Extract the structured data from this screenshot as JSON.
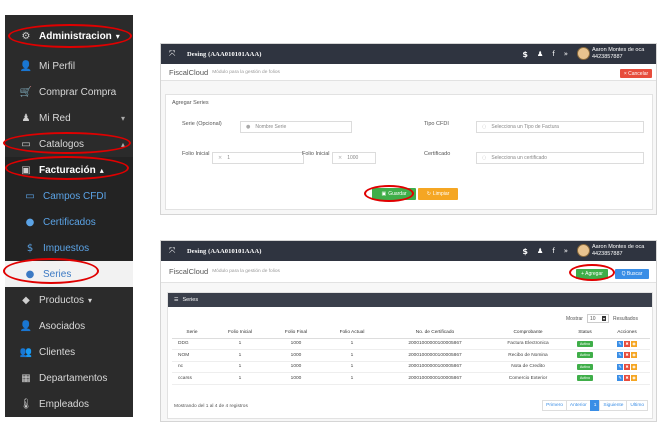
{
  "sidebar": {
    "items": [
      {
        "icon": "⚙",
        "label": "Administracion",
        "caret": "▾"
      },
      {
        "icon": "👤",
        "label": "Mi Perfil"
      },
      {
        "icon": "🛒",
        "label": "Comprar Compra"
      },
      {
        "icon": "♟",
        "label": "Mi Red",
        "right_caret": "▾"
      },
      {
        "icon": "▭",
        "label": "Catalogos",
        "right_caret": "▴"
      },
      {
        "icon": "▣",
        "label": "Facturación",
        "caret": "▴"
      },
      {
        "icon": "▭",
        "label": "Campos CFDI"
      },
      {
        "icon": "●",
        "label": "Certificados"
      },
      {
        "icon": "$",
        "label": "Impuestos"
      },
      {
        "icon": "●",
        "label": "Series"
      },
      {
        "icon": "◆",
        "label": "Productos",
        "caret": "▾"
      },
      {
        "icon": "👤",
        "label": "Asociados"
      },
      {
        "icon": "👥",
        "label": "Clientes"
      },
      {
        "icon": "▦",
        "label": "Departamentos"
      },
      {
        "icon": "🌡",
        "label": "Empleados"
      }
    ]
  },
  "top_panel": {
    "topbar_title": "Desing  (AAA010101AAA)",
    "user_name": "Aaron Montes de oca",
    "user_phone": "4423857887",
    "brand": "FiscalCloud",
    "brand_desc": "Módulo para la gestión de folios",
    "cancel_btn": "× Cancelar",
    "form_title": "Agregar Series",
    "serie_label": "Serie (Opcional)",
    "serie_placeholder": "Nombre Serie",
    "tipo_label": "Tipo CFDI",
    "tipo_placeholder": "Selecciona un Tipo de Factura",
    "folio_inicial_label": "Folio Inicial",
    "folio_inicial_value": "1",
    "folio_final_label": "Folio Inicial",
    "folio_final_value": "1000",
    "cert_label": "Certificado",
    "cert_placeholder": "Selecciona un certificado",
    "guardar_btn": "Guardar",
    "limpiar_btn": "Limpiar"
  },
  "bottom_panel": {
    "topbar_title": "Desing  (AAA010101AAA)",
    "user_name": "Aaron Montes de oca",
    "user_phone": "4423857887",
    "brand": "FiscalCloud",
    "brand_desc": "Módulo para la gestión de folios",
    "agregar_btn": "+ Agregar",
    "buscar_btn": "Q Buscar",
    "table_title": "Series",
    "mostrar_label": "Mostrar",
    "mostrar_value": "10",
    "resultados_label": "Resultados",
    "columns": [
      "Serie",
      "Folio Inicial",
      "Folio Final",
      "Folio Actual",
      "No. de Certificado",
      "Comprobante",
      "Status",
      "Acciones"
    ],
    "rows": [
      {
        "serie": "DDG",
        "inicial": "1",
        "final": "1000",
        "actual": "1",
        "cert": "20001000000100005867",
        "comprobante": "Factura Electronica",
        "status": "Activo"
      },
      {
        "serie": "NOM",
        "inicial": "1",
        "final": "1000",
        "actual": "1",
        "cert": "20001000000100005867",
        "comprobante": "Recibo de Nomina",
        "status": "Activo"
      },
      {
        "serie": "nc",
        "inicial": "1",
        "final": "1000",
        "actual": "1",
        "cert": "20001000000100005867",
        "comprobante": "Nota de Credito",
        "status": "Activo"
      },
      {
        "serie": "ccarss",
        "inicial": "1",
        "final": "1000",
        "actual": "1",
        "cert": "20001000000100005867",
        "comprobante": "Comercio Exterior",
        "status": "Activo"
      }
    ],
    "footer_text": "Mostrando del 1 al 4 de 4 registros",
    "pager": [
      "Primero",
      "Anterior",
      "1",
      "Siguiente",
      "Ultimo"
    ]
  }
}
